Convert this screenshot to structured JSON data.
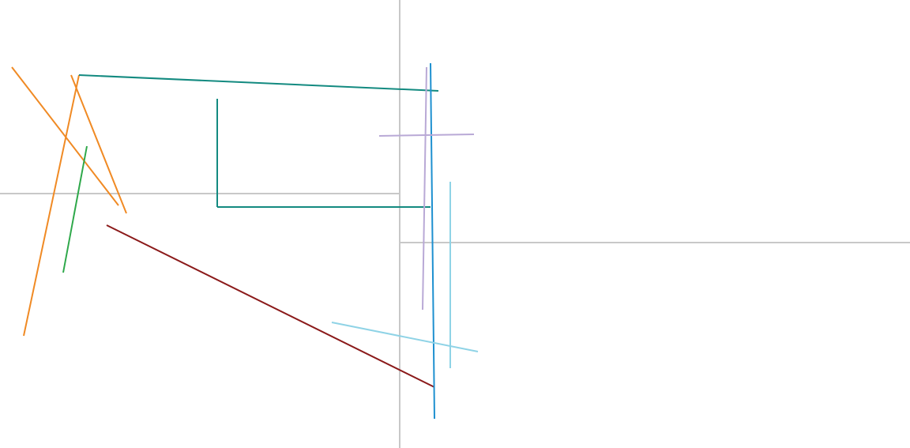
{
  "panels": [
    {
      "name": "top-left-panel"
    },
    {
      "name": "bottom-left-panel"
    },
    {
      "name": "top-right-panel"
    },
    {
      "name": "bottom-right-panel"
    }
  ],
  "colors": {
    "background": "#ffffff",
    "divider": "#c8c8c8",
    "keyword": "#7f0055",
    "orange": "#f08a24",
    "teal": "#138a80",
    "green": "#2ea84a",
    "dark_red": "#8b1a1a",
    "red": "#e02020",
    "blue": "#1e90d0",
    "lavender": "#b9a9d6",
    "light_blue": "#8fd3e6",
    "yellow_green": "#c8d64a",
    "tan": "#e8d8a0"
  }
}
